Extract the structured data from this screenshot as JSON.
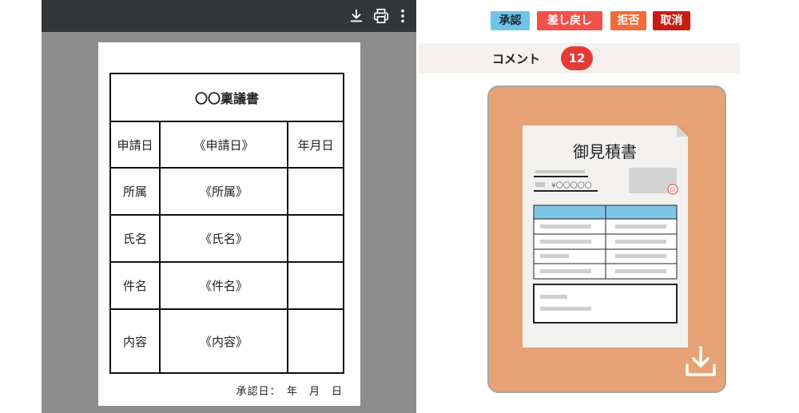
{
  "viewer": {
    "toolbar": {
      "icons": [
        "download-icon",
        "print-icon",
        "more-vert-icon"
      ]
    },
    "document": {
      "title": "〇〇稟議書",
      "rows": [
        {
          "label": "申請日",
          "value": "《申請日》",
          "extra": "年月日"
        },
        {
          "label": "所属",
          "value": "《所属》",
          "extra": ""
        },
        {
          "label": "氏名",
          "value": "《氏名》",
          "extra": ""
        },
        {
          "label": "件名",
          "value": "《件名》",
          "extra": ""
        },
        {
          "label": "内容",
          "value": "《内容》",
          "extra": ""
        }
      ],
      "approval_date": "承認日：　年　月　日"
    }
  },
  "actions": {
    "approve": "承認",
    "remand": "差し戻し",
    "reject": "拒否",
    "cancel": "取消"
  },
  "comments": {
    "label": "コメント",
    "count": "12"
  },
  "attachment": {
    "thumbnail_title": "御見積書",
    "thumbnail_amount": "¥〇〇〇〇〇",
    "thumbnail_seal": "印",
    "icon": "download-icon"
  },
  "colors": {
    "approve": "#6ec3e8",
    "remand": "#f2514a",
    "reject": "#f26b3a",
    "cancel": "#c91d14",
    "badge": "#e83a34",
    "card": "#e7a275"
  }
}
